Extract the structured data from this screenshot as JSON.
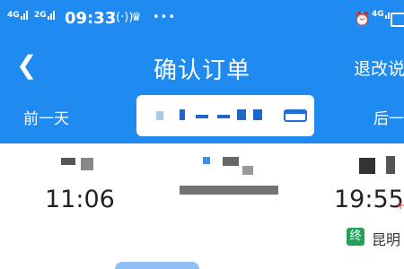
{
  "status_bar": {
    "signal_1": "4G",
    "signal_2": "2G",
    "time": "09:33",
    "signal_right": "4G",
    "icons": [
      "vibrate-icon",
      "crown-icon",
      "more-dots-icon",
      "alarm-icon",
      "battery-icon"
    ]
  },
  "nav": {
    "back_icon": "chevron-left-icon",
    "title": "确认订单",
    "right_link": "退改说"
  },
  "date_bar": {
    "prev_label": "前一天",
    "next_label": "后一",
    "calendar_icon": "calendar-icon"
  },
  "train": {
    "departure_time": "11:06",
    "arrival_time": "19:55",
    "arrival_day_marker": "+",
    "end_badge": "终",
    "end_station": "昆明"
  },
  "colors": {
    "header_blue": "#1f8af0",
    "end_badge_green": "#23a35a",
    "day_marker_red": "#e53935"
  }
}
